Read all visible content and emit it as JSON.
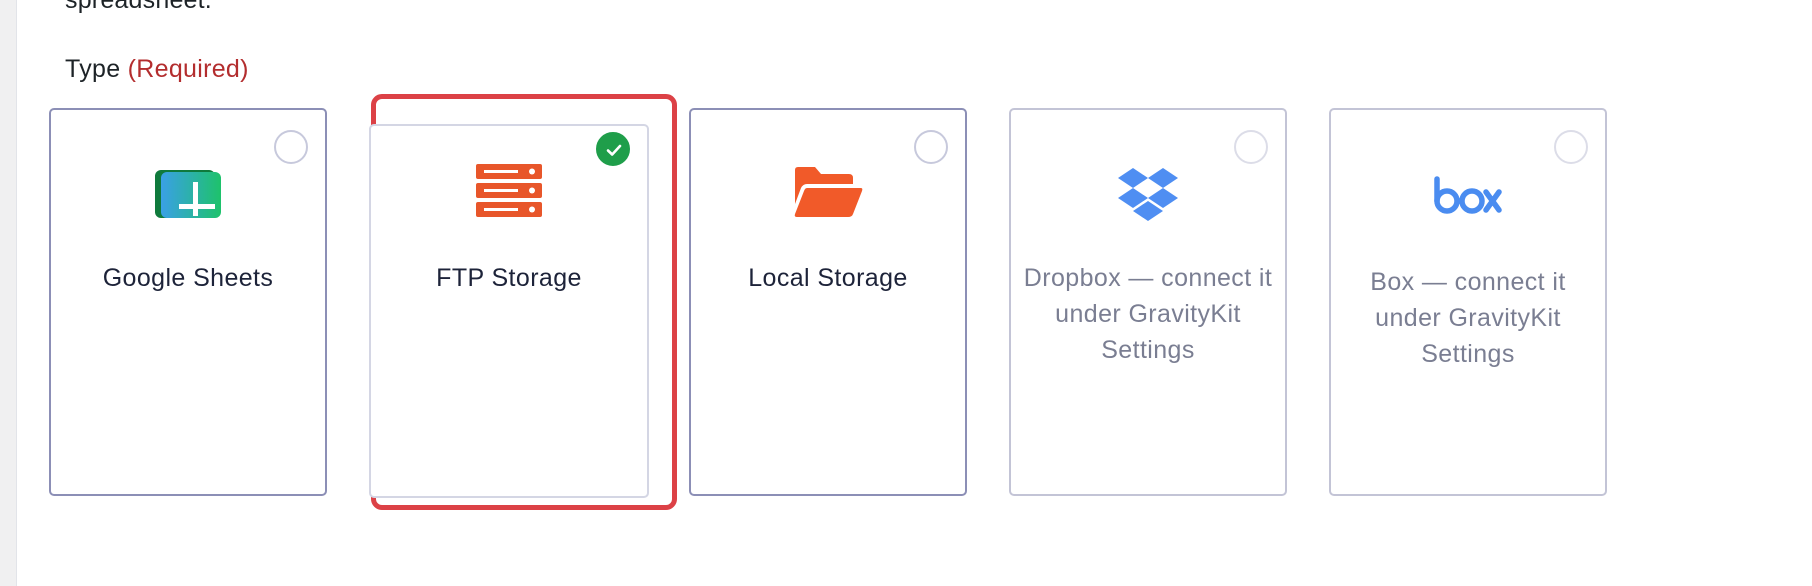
{
  "intro_text": "spreadsheet.",
  "type_label": "Type",
  "type_required": "(Required)",
  "options": [
    {
      "label": "Google Sheets",
      "icon": "google-sheets-icon",
      "selected": false,
      "disabled": false
    },
    {
      "label": "FTP Storage",
      "icon": "ftp-server-icon",
      "selected": true,
      "disabled": false
    },
    {
      "label": "Local Storage",
      "icon": "folder-icon",
      "selected": false,
      "disabled": false
    },
    {
      "label": "Dropbox — connect it under GravityKit Settings",
      "icon": "dropbox-icon",
      "selected": false,
      "disabled": true
    },
    {
      "label": "Box — connect it under GravityKit Settings",
      "icon": "box-icon",
      "selected": false,
      "disabled": true
    }
  ],
  "colors": {
    "selected_outline": "#dc4146",
    "required": "#b32d2e",
    "check": "#1f9e4a",
    "ftp_icon": "#e8562a",
    "folder_icon": "#f15a29",
    "dropbox_icon": "#4f8ef2",
    "box_icon": "#4a8cf0"
  }
}
